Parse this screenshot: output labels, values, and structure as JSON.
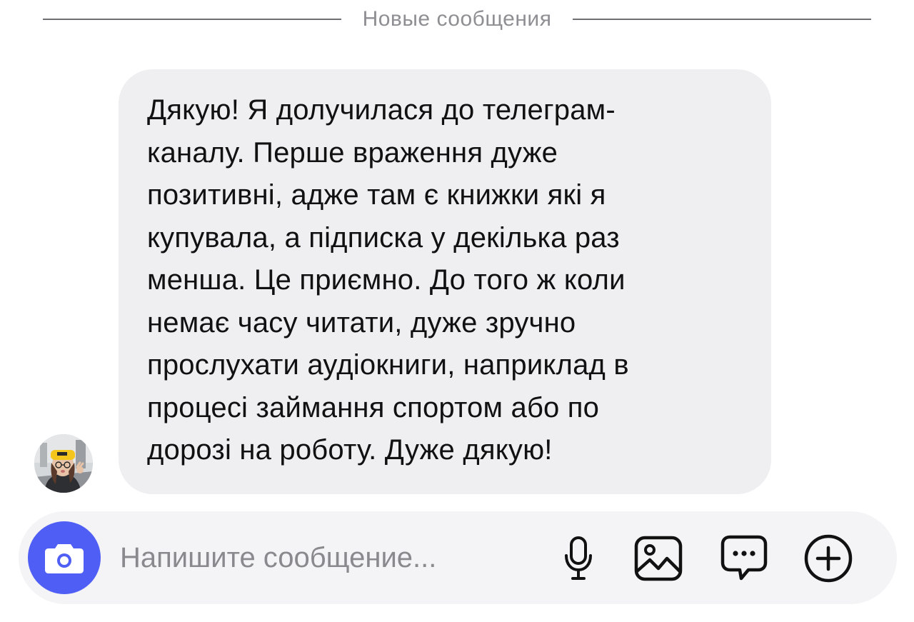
{
  "separator": {
    "label": "Новые сообщения"
  },
  "message": {
    "text": "Дякую! Я долучилася до телеграм-\nканалу. Перше враження дуже\nпозитивні, адже там є книжки які я\nкупувала, а підписка у декілька раз\nменша. Це приємно. До того ж коли\nнемає часу читати, дуже зручно\nпрослухати аудіокниги, наприклад в\nпроцесі займання спортом або по\nдорозі на роботу. Дуже дякую!"
  },
  "composer": {
    "placeholder": "Напишите сообщение..."
  },
  "icons": {
    "camera": "camera-icon",
    "microphone": "microphone-icon",
    "gallery": "image-icon",
    "sticker": "chat-bubble-icon",
    "more": "plus-circle-icon"
  },
  "colors": {
    "accent": "#4f5ff5",
    "bubble": "#efeff2",
    "composer": "#f4f4f6",
    "separator": "#8e8e93"
  }
}
